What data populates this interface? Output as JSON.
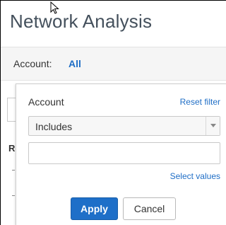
{
  "page": {
    "title": "Network Analysis"
  },
  "account_bar": {
    "label": "Account:",
    "value": "All"
  },
  "background": {
    "partial_heading": "Re"
  },
  "filter_popover": {
    "title": "Account",
    "reset_label": "Reset filter",
    "operator": {
      "selected": "Includes"
    },
    "value_input": "",
    "select_values_label": "Select values",
    "apply_label": "Apply",
    "cancel_label": "Cancel"
  },
  "colors": {
    "link": "#1f6ec6",
    "primary_button": "#1e6fc8",
    "title_text": "#44505c",
    "bar_background": "#f5f5f5"
  },
  "icons": {
    "cursor": "mouse-pointer-icon",
    "dropdown": "chevron-down-icon"
  }
}
